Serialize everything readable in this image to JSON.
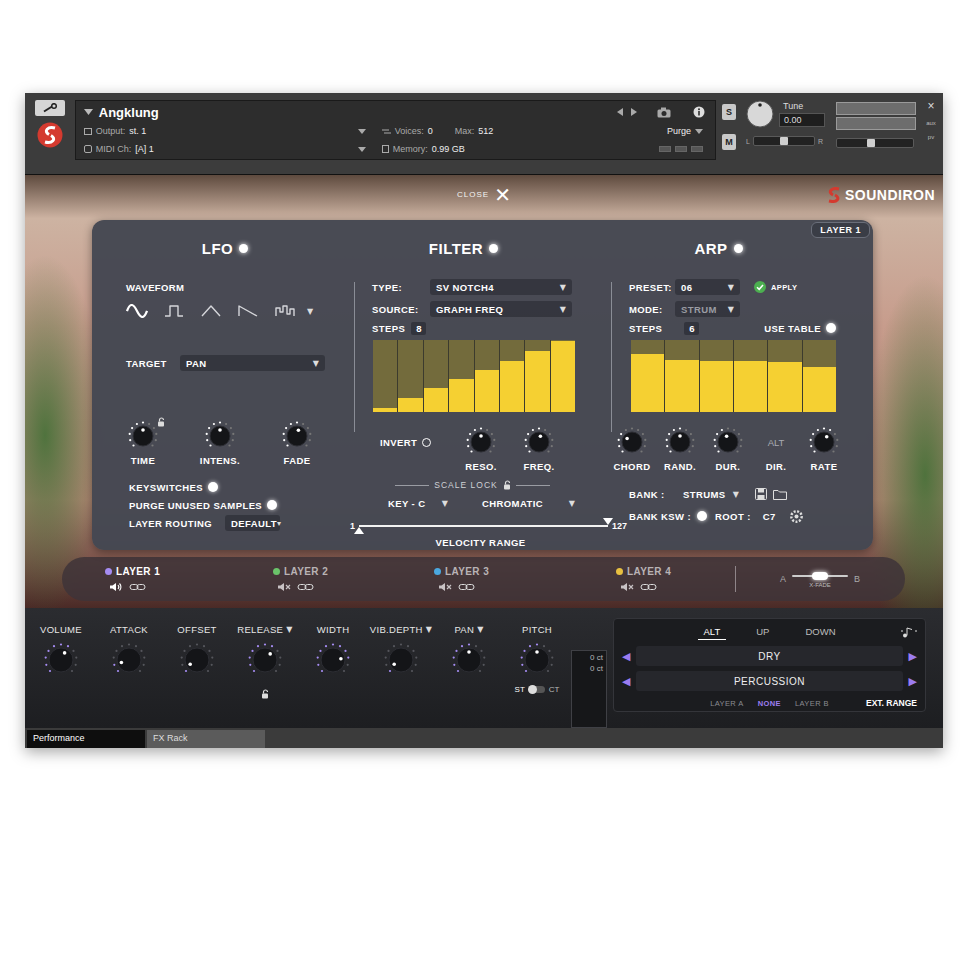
{
  "header": {
    "title": "Angklung",
    "output_label": "Output:",
    "output": "st. 1",
    "midi_label": "MIDI Ch:",
    "midi": "[A] 1",
    "voices_label": "Voices:",
    "voices": "0",
    "max_label": "Max:",
    "max": "512",
    "memory_label": "Memory:",
    "memory": "0.99 GB",
    "purge": "Purge",
    "solo": "S",
    "mute": "M",
    "tune_label": "Tune",
    "tune": "0.00",
    "tune_level": 0.5,
    "pan_left": "L",
    "pan_right": "R",
    "pan_level": 0.5,
    "volume_level": 0.45,
    "meter_levels": [
      0,
      0
    ],
    "close": "×",
    "aux": "aux",
    "pv": "pv"
  },
  "instrument": {
    "close_label": "CLOSE",
    "close_icon": "✕",
    "brand": "SOUNDIRON",
    "layer_tag": "LAYER 1",
    "arrow": "▼",
    "lfo": {
      "title": "LFO",
      "on": true,
      "waveform_label": "WAVEFORM",
      "waveforms": [
        {
          "kind": "sine",
          "selected": true
        },
        {
          "kind": "square",
          "selected": false
        },
        {
          "kind": "triangle",
          "selected": false
        },
        {
          "kind": "saw",
          "selected": false
        },
        {
          "kind": "random",
          "selected": false
        }
      ],
      "waveform_more": "▼",
      "target_label": "TARGET",
      "target": "PAN",
      "knobs": [
        {
          "label": "TIME",
          "level": 0.5,
          "lock": true
        },
        {
          "label": "INTENS.",
          "level": 0.5,
          "lock": false
        },
        {
          "label": "FADE",
          "level": 0.55,
          "lock": false
        }
      ],
      "toggles": [
        {
          "label": "KEYSWITCHES",
          "on": true
        },
        {
          "label": "PURGE UNUSED SAMPLES",
          "on": true
        }
      ],
      "routing_label": "LAYER ROUTING",
      "routing": "DEFAULT",
      "routing_arrow": "▾"
    },
    "filter": {
      "title": "FILTER",
      "on": true,
      "type_label": "TYPE:",
      "type": "SV NOTCH4",
      "source_label": "SOURCE:",
      "source": "GRAPH FREQ",
      "steps_label": "STEPS",
      "steps": "8",
      "graph": [
        0.06,
        0.2,
        0.33,
        0.46,
        0.59,
        0.71,
        0.85,
        0.98
      ],
      "invert_label": "INVERT",
      "invert": false,
      "knobs": [
        {
          "label": "RESO.",
          "level": 0.5
        },
        {
          "label": "FREQ.",
          "level": 0.55
        }
      ],
      "scale_lock_label": "SCALE LOCK",
      "key": "KEY - C",
      "scale": "CHROMATIC",
      "velocity_label": "VELOCITY RANGE",
      "velocity_min": "1",
      "velocity_max": "127",
      "velocity_low": 0.0,
      "velocity_high": 1.0
    },
    "arp": {
      "title": "ARP",
      "on": true,
      "preset_label": "PRESET:",
      "preset": "06",
      "apply": "APPLY",
      "mode_label": "MODE:",
      "mode": "STRUM",
      "mode_disabled": true,
      "steps_label": "STEPS",
      "steps": "6",
      "use_table_label": "USE TABLE",
      "use_table": true,
      "graph": [
        0.8,
        0.72,
        0.71,
        0.71,
        0.69,
        0.62
      ],
      "controls": [
        {
          "kind": "knob",
          "label": "CHORD",
          "level": 0.3
        },
        {
          "kind": "knob",
          "label": "RAND.",
          "level": 0.5
        },
        {
          "kind": "knob",
          "label": "DUR.",
          "level": 0.45
        },
        {
          "kind": "selector",
          "label": "DIR.",
          "value": "ALT"
        },
        {
          "kind": "knob",
          "label": "RATE",
          "level": 0.6
        }
      ],
      "bank_label": "BANK :",
      "bank": "STRUMS",
      "bank_ksw_label": "BANK KSW :",
      "bank_ksw": true,
      "root_label": "ROOT :",
      "root": "C7"
    }
  },
  "layers": [
    {
      "label": "LAYER 1",
      "color": "#a58cf2",
      "selected": true,
      "muted": false
    },
    {
      "label": "LAYER 2",
      "color": "#6ac46a",
      "selected": false,
      "muted": true
    },
    {
      "label": "LAYER 3",
      "color": "#4aa8e0",
      "selected": false,
      "muted": true
    },
    {
      "label": "LAYER 4",
      "color": "#e8c040",
      "selected": false,
      "muted": true
    }
  ],
  "xfade": {
    "label": "X-FADE",
    "a": "A",
    "b": "B",
    "level": 0.5
  },
  "controls": {
    "menu_arrow": "▼",
    "knobs": [
      {
        "label": "VOLUME",
        "level": 0.6,
        "has_menu": false,
        "lock": false,
        "units": false
      },
      {
        "label": "ATTACK",
        "level": 0.1,
        "has_menu": false,
        "lock": false,
        "units": false
      },
      {
        "label": "OFFSET",
        "level": 0.05,
        "has_menu": false,
        "lock": false,
        "units": false
      },
      {
        "label": "RELEASE",
        "level": 0.65,
        "has_menu": true,
        "lock": true,
        "units": false
      },
      {
        "label": "WIDTH",
        "level": 0.8,
        "has_menu": false,
        "lock": false,
        "units": false
      },
      {
        "label": "VIB.DEPTH",
        "level": 0.05,
        "has_menu": true,
        "lock": false,
        "units": false
      },
      {
        "label": "PAN",
        "level": 0.5,
        "has_menu": true,
        "lock": false,
        "units": false
      },
      {
        "label": "PITCH",
        "level": 0.5,
        "has_menu": false,
        "lock": false,
        "units": true
      }
    ],
    "pitch_readouts": [
      "0 ct",
      "0 ct"
    ],
    "pitch_units": [
      {
        "label": "ST",
        "selected": true
      },
      {
        "label": "CT",
        "selected": false
      }
    ]
  },
  "articulations": {
    "tabs": [
      {
        "label": "ALT",
        "selected": true
      },
      {
        "label": "UP",
        "selected": false
      },
      {
        "label": "DOWN",
        "selected": false
      }
    ],
    "rows": [
      "DRY",
      "PERCUSSION"
    ],
    "prev": "◀",
    "next": "▶",
    "targets": [
      {
        "label": "LAYER A",
        "selected": false
      },
      {
        "label": "NONE",
        "selected": true
      },
      {
        "label": "LAYER B",
        "selected": false
      }
    ],
    "ext_range": "EXT. RANGE"
  },
  "tabs": [
    {
      "label": "Performance",
      "selected": true
    },
    {
      "label": "FX Rack",
      "selected": false
    }
  ]
}
